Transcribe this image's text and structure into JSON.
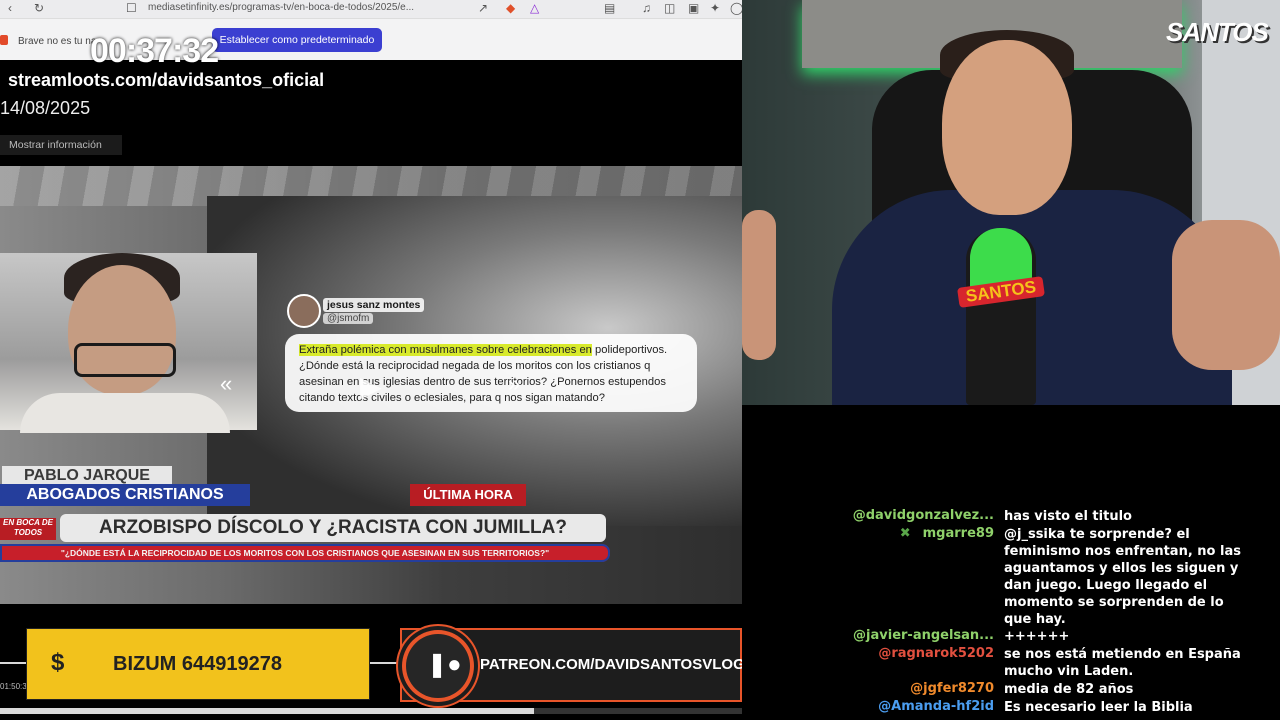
{
  "browser": {
    "url": "mediasetinfinity.es/programas-tv/en-boca-de-todos/2025/e...",
    "warning_text": "Brave no es tu na",
    "default_button": "Establecer como predeterminado"
  },
  "overlay": {
    "timer": "00:37:32",
    "stream_url": "streamloots.com/davidsantos_oficial",
    "date": "14/08/2025",
    "info_button": "Mostrar información"
  },
  "tweet": {
    "name": "jesus sanz montes",
    "handle": "@jsmofm",
    "text_highlight": "Extraña polémica con musulmanes sobre celebraciones en",
    "text_rest": " polideportivos. ¿Dónde está la reciprocidad negada de los moritos con los cristianos q asesinan en sus iglesias dentro de sus territorios? ¿Ponernos estupendos citando textos civiles o eclesiales, para q nos sigan matando?"
  },
  "lower_third": {
    "guest_name": "PABLO JARQUE",
    "guest_org": "ABOGADOS CRISTIANOS",
    "breaking": "ÚLTIMA HORA",
    "show_logo": "EN BOCA DE TODOS",
    "headline": "ARZOBISPO DÍSCOLO Y ¿RACISTA CON JUMILLA?",
    "subheadline": "\"¿DÓNDE ESTÁ LA RECIPROCIDAD DE LOS MORITOS CON LOS CRISTIANOS QUE ASESINAN EN SUS TERRITORIOS?\""
  },
  "banners": {
    "bizum": "BIZUM 644919278",
    "patreon": "PATREON.COM/DAVIDSANTOSVLOG",
    "elapsed": "01:50:3"
  },
  "player": {
    "progress": 0.72
  },
  "webcam": {
    "logo": "SANTOS",
    "mic_label": "SANTOS"
  },
  "chat": {
    "messages": [
      {
        "user": "@davidgonzalvez...",
        "color": "#8fd16a",
        "mod": false,
        "text": "has visto el titulo"
      },
      {
        "user": "mgarre89",
        "color": "#8fd16a",
        "mod": true,
        "text": "@j_ssika te sorprende? el feminismo nos enfrentan, no las aguantamos y ellos les siguen y dan juego. Luego llegado el momento se sorprenden de lo que hay."
      },
      {
        "user": "@javier-angelsan...",
        "color": "#8fd16a",
        "mod": false,
        "text": "++++++"
      },
      {
        "user": "@ragnarok5202",
        "color": "#e2503f",
        "mod": false,
        "text": "se nos está metiendo en España mucho vin Laden."
      },
      {
        "user": "@jgfer8270",
        "color": "#f08a2c",
        "mod": false,
        "text": "media de 82 años"
      },
      {
        "user": "@Amanda-hf2id",
        "color": "#4b9df0",
        "mod": false,
        "text": "Es necesario leer la Biblia"
      }
    ]
  }
}
